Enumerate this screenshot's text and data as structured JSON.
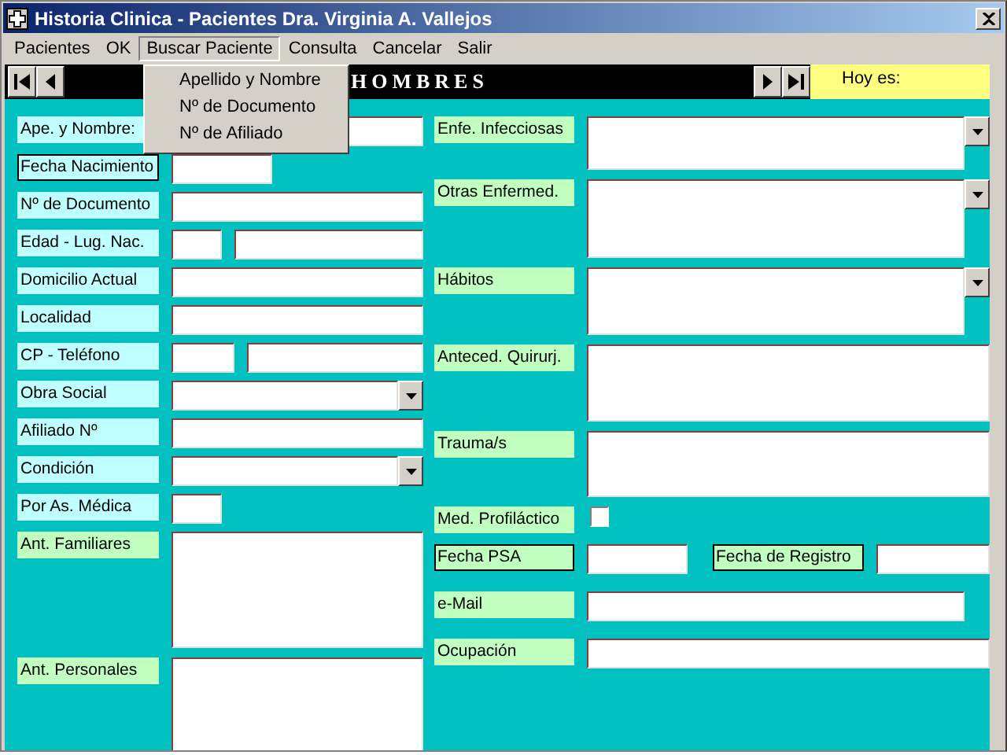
{
  "window": {
    "title": "Historia Clinica - Pacientes Dra. Virginia A. Vallejos"
  },
  "menus": [
    {
      "label": "Pacientes",
      "selected": false
    },
    {
      "label": "OK",
      "selected": false
    },
    {
      "label": "Buscar Paciente",
      "selected": true
    },
    {
      "label": "Consulta",
      "selected": false
    },
    {
      "label": "Cancelar",
      "selected": false
    },
    {
      "label": "Salir",
      "selected": false
    }
  ],
  "open_menu": {
    "items": [
      "Apellido y Nombre",
      "Nº de Documento",
      "Nº de Afiliado"
    ]
  },
  "record_bar": {
    "title": "HOMBRES",
    "today_label": "Hoy es:"
  },
  "left_fields": [
    {
      "kind": "text",
      "label": "Ape. y Nombre:",
      "color": "#c0ffff",
      "boxed": false
    },
    {
      "kind": "short",
      "label": "Fecha Nacimiento",
      "color": "#c0ffff",
      "boxed": true
    },
    {
      "kind": "text",
      "label": "Nº de Documento",
      "color": "#c0ffff",
      "boxed": false
    },
    {
      "kind": "pair",
      "label": "Edad - Lug. Nac.",
      "color": "#c0ffff",
      "boxed": false
    },
    {
      "kind": "text",
      "label": "Domicilio Actual",
      "color": "#c0ffff",
      "boxed": false
    },
    {
      "kind": "text",
      "label": "Localidad",
      "color": "#c0ffff",
      "boxed": false
    },
    {
      "kind": "pair",
      "label": "CP - Teléfono",
      "color": "#c0ffff",
      "boxed": false
    },
    {
      "kind": "combo",
      "label": "Obra Social",
      "color": "#c0ffff",
      "boxed": false
    },
    {
      "kind": "text",
      "label": "Afiliado Nº",
      "color": "#c0ffff",
      "boxed": false
    },
    {
      "kind": "combo",
      "label": "Condición",
      "color": "#c0ffff",
      "boxed": false
    },
    {
      "kind": "tiny",
      "label": "Por As. Médica",
      "color": "#c0ffff",
      "boxed": false
    },
    {
      "kind": "memo",
      "label": "Ant. Familiares",
      "color": "#c0ffc0",
      "boxed": false
    },
    {
      "kind": "memo",
      "label": "Ant. Personales",
      "color": "#c0ffc0",
      "boxed": false
    }
  ],
  "right_fields": [
    {
      "kind": "combo_memo",
      "label": "Enfe. Infecciosas",
      "boxed": false
    },
    {
      "kind": "combo_memo",
      "label": "Otras Enfermed.",
      "boxed": false
    },
    {
      "kind": "combo_memo",
      "label": "Hábitos",
      "boxed": false
    },
    {
      "kind": "memo",
      "label": "Anteced. Quirurj.",
      "boxed": false
    },
    {
      "kind": "memo",
      "label": "Trauma/s",
      "boxed": false
    },
    {
      "kind": "checkbox",
      "label": "Med. Profiláctico",
      "boxed": false,
      "checked": false
    },
    {
      "kind": "date",
      "label": "Fecha PSA",
      "boxed": true,
      "second_label": "Fecha de Registro",
      "second_boxed": true
    },
    {
      "kind": "email",
      "label": "e-Mail",
      "boxed": false
    },
    {
      "kind": "text",
      "label": "Ocupación",
      "boxed": false
    }
  ]
}
